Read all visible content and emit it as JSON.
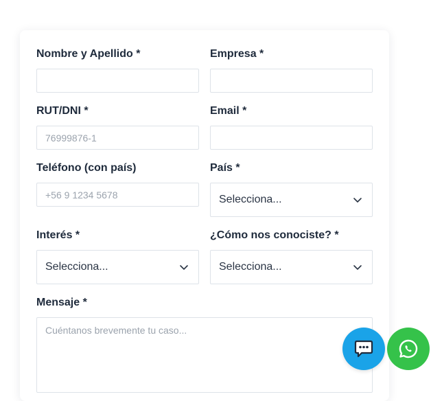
{
  "form": {
    "name_label": "Nombre y Apellido *",
    "name_value": "",
    "company_label": "Empresa *",
    "company_value": "",
    "rut_label": "RUT/DNI *",
    "rut_placeholder": "76999876-1",
    "email_label": "Email *",
    "email_value": "",
    "phone_label": "Teléfono (con país)",
    "phone_placeholder": "+56 9 1234 5678",
    "country_label": "País *",
    "country_value": "Selecciona...",
    "interest_label": "Interés *",
    "interest_value": "Selecciona...",
    "source_label": "¿Cómo nos conociste? *",
    "source_value": "Selecciona...",
    "message_label": "Mensaje *",
    "message_placeholder": "Cuéntanos brevemente tu caso..."
  },
  "floating": {
    "chat_icon": "chat-bubble-icon",
    "chat_color": "#1aa3e8",
    "whatsapp_icon": "whatsapp-icon",
    "whatsapp_color": "#35c24a"
  }
}
